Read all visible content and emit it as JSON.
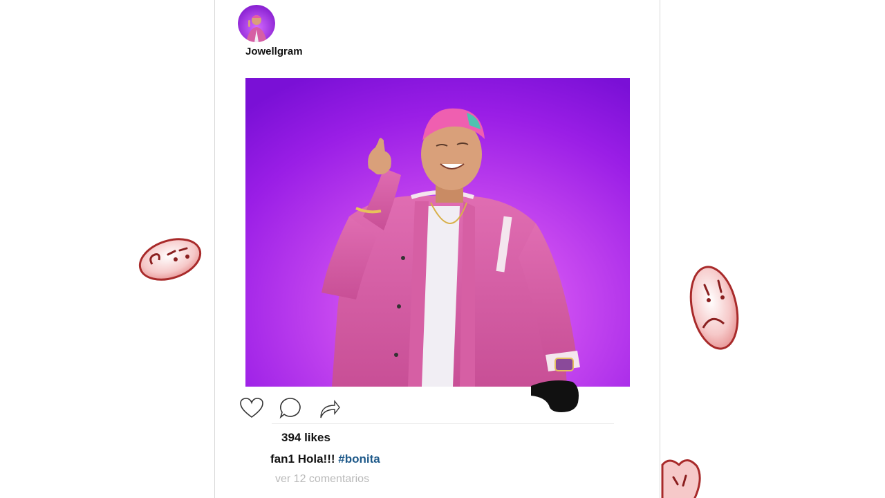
{
  "post": {
    "username": "Jowellgram",
    "likes": "394 likes",
    "caption_user": "fan1",
    "caption_text": "Hola!!!",
    "hashtag": "#bonita",
    "view_comments": "ver 12 comentarios"
  },
  "icons": {
    "like": "heart-icon",
    "comment": "comment-icon",
    "share": "share-arrow-icon"
  },
  "colors": {
    "photo_background": "#9a1ee6",
    "jacket": "#d65fa4",
    "hashtag": "#1f5a8a",
    "sticker": "#f2b8b8"
  }
}
